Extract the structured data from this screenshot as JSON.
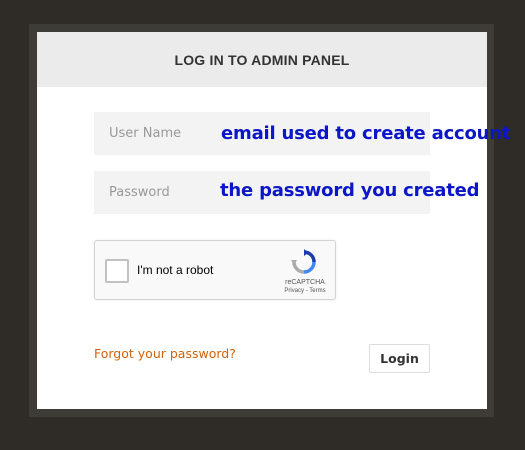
{
  "panel": {
    "title": "LOG IN TO ADMIN PANEL"
  },
  "form": {
    "username_placeholder": "User Name",
    "password_placeholder": "Password",
    "username_annotation": "email used to create account",
    "password_annotation": "the password you created"
  },
  "recaptcha": {
    "label": "I'm not a robot",
    "brand": "reCAPTCHA",
    "terms": "Privacy - Terms",
    "logo_icon": "recaptcha-logo-icon"
  },
  "links": {
    "forgot": "Forgot your password?"
  },
  "buttons": {
    "login": "Login"
  },
  "colors": {
    "annotation": "#0a16c8",
    "link": "#d0620a",
    "background": "#2f2c27"
  }
}
